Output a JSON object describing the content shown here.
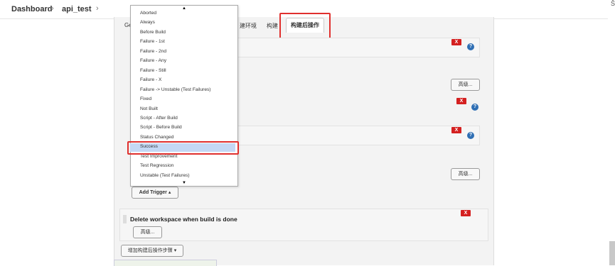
{
  "breadcrumb": {
    "items": [
      "Dashboard",
      "api_test"
    ],
    "separator": "›"
  },
  "corner_glyph": "Ŝ",
  "tabs": {
    "items": [
      "Ge",
      "建环境",
      "构建"
    ],
    "active": "构建后操作"
  },
  "dropdown": {
    "items": [
      "Aborted",
      "Always",
      "Before Build",
      "Failure - 1st",
      "Failure - 2nd",
      "Failure - Any",
      "Failure - Still",
      "Failure - X",
      "Failure -> Unstable (Test Failures)",
      "Fixed",
      "Not Built",
      "Script - After Build",
      "Script - Before Build",
      "Status Changed",
      "Success",
      "Test Improvement",
      "Test Regression",
      "Unstable (Test Failures)"
    ],
    "selected": "Success",
    "scroll_up": "▲",
    "scroll_down": "▼"
  },
  "buttons": {
    "delete_label": "X",
    "help_label": "?",
    "advanced_label": "高级...",
    "add_trigger_label": "Add Trigger ▴",
    "add_post_build_label": "增加构建后操作步骤 ▾"
  },
  "workspace_section": {
    "title": "Delete workspace when build is done"
  },
  "colors": {
    "highlight": "#e0302e",
    "delete": "#d42020",
    "help": "#2f6fb4",
    "selection": "#c4d8f5"
  }
}
